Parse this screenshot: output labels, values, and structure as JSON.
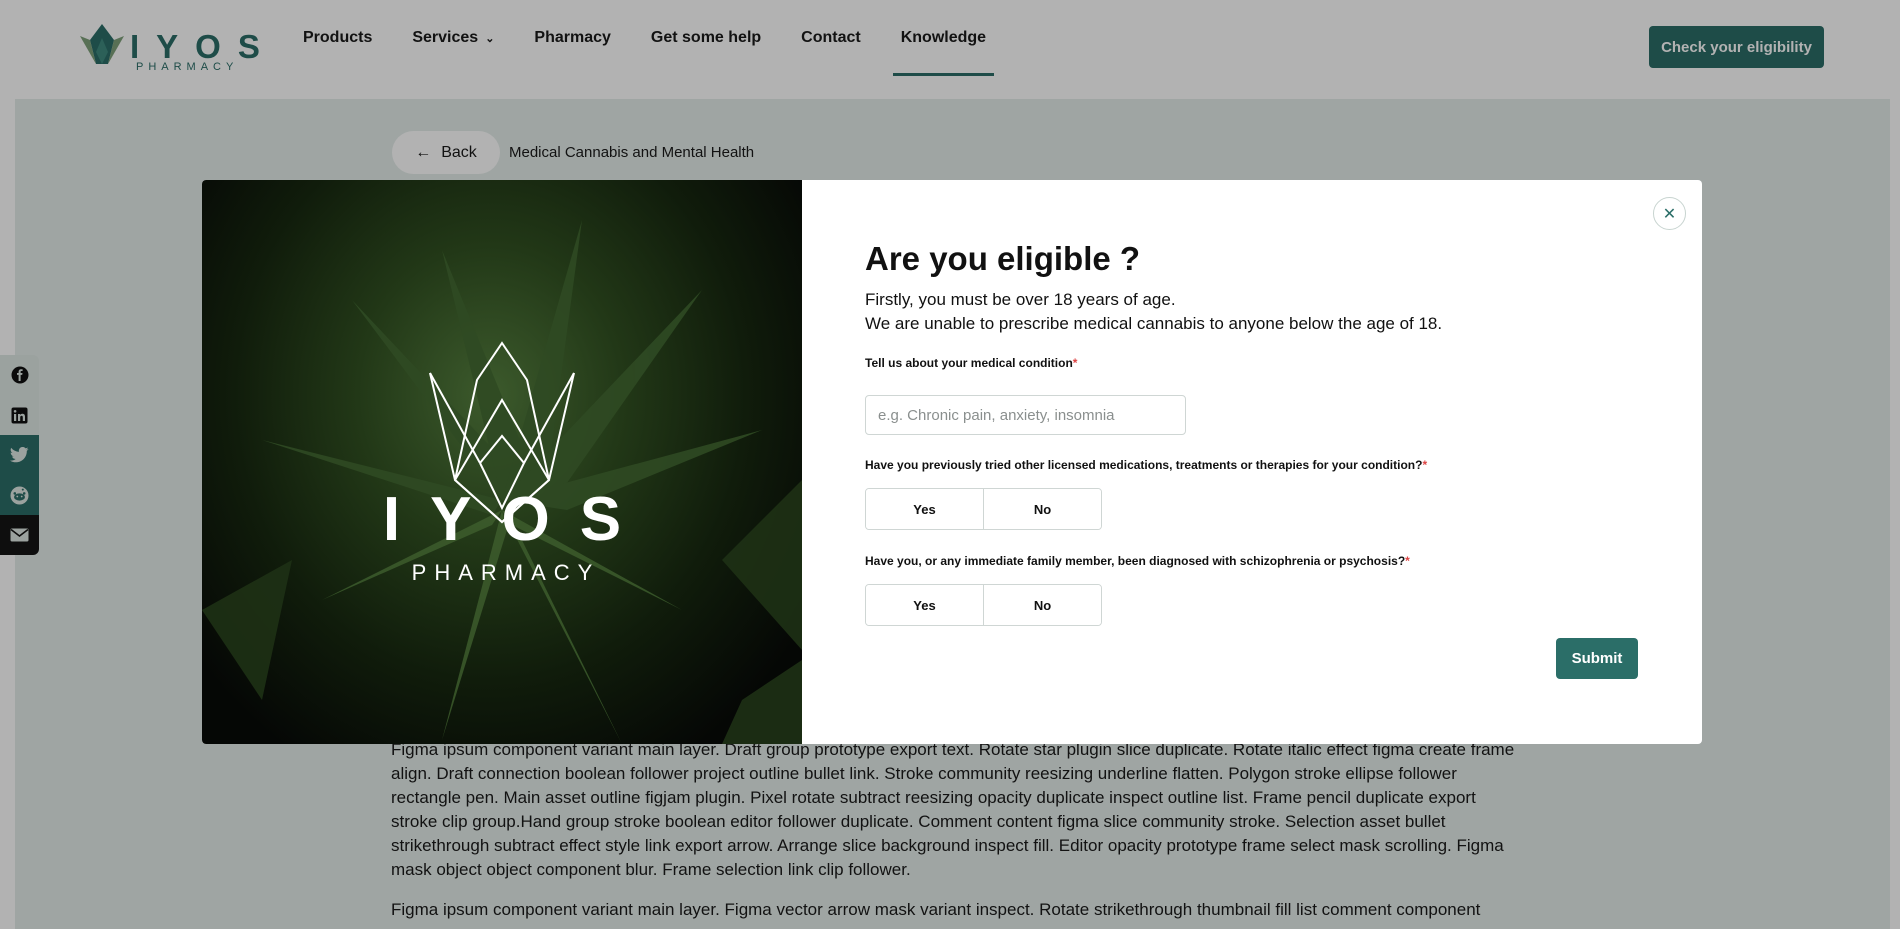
{
  "brand": {
    "name": "IYOS",
    "sub": "PHARMACY",
    "accent_color": "#2b6e68"
  },
  "nav": {
    "links": [
      {
        "label": "Products"
      },
      {
        "label": "Services"
      },
      {
        "label": "Pharmacy"
      },
      {
        "label": "Get some help"
      },
      {
        "label": "Contact"
      },
      {
        "label": "Knowledge"
      }
    ],
    "active": "Knowledge",
    "cta_label": "Check your eligibility"
  },
  "page": {
    "back_label": "Back",
    "breadcrumb": "Medical Cannabis and Mental Health",
    "paragraphs": [
      "Figma ipsum component variant main layer. Draft group prototype export text. Rotate star plugin slice duplicate. Rotate italic effect figma create frame align. Draft connection boolean follower project outline bullet link. Stroke community reesizing underline flatten. Polygon stroke ellipse follower rectangle pen. Main asset outline figjam plugin. Pixel rotate subtract reesizing opacity duplicate inspect outline list. Frame pencil duplicate export stroke clip group.Hand group stroke boolean editor follower duplicate. Comment content figma slice community stroke. Selection asset bullet strikethrough subtract effect style link export arrow. Arrange slice background inspect fill. Editor opacity prototype frame select mask scrolling. Figma mask object object component blur. Frame selection link clip follower.",
      "Figma ipsum component variant main layer. Figma vector arrow mask variant inspect. Rotate strikethrough thumbnail fill list comment component"
    ]
  },
  "share": {
    "items": [
      "facebook-icon",
      "linkedin-icon",
      "twitter-icon",
      "reddit-icon",
      "email-icon"
    ]
  },
  "modal": {
    "image_logo_word": "IYOS",
    "image_logo_sub": "PHARMACY",
    "title": "Are you eligible ?",
    "intro_line1": "Firstly, you must be over 18 years of age.",
    "intro_line2": "We are unable to prescribe medical cannabis to anyone below the age of 18.",
    "q1_label": "Tell us about your medical condition",
    "q1_placeholder": "e.g. Chronic pain, anxiety, insomnia",
    "q2_label": "Have you previously tried other licensed medications, treatments or therapies for your condition?",
    "q3_label": "Have you, or any immediate family member, been diagnosed with schizophrenia or psychosis?",
    "required_mark": "*",
    "yes_label": "Yes",
    "no_label": "No",
    "submit_label": "Submit"
  }
}
